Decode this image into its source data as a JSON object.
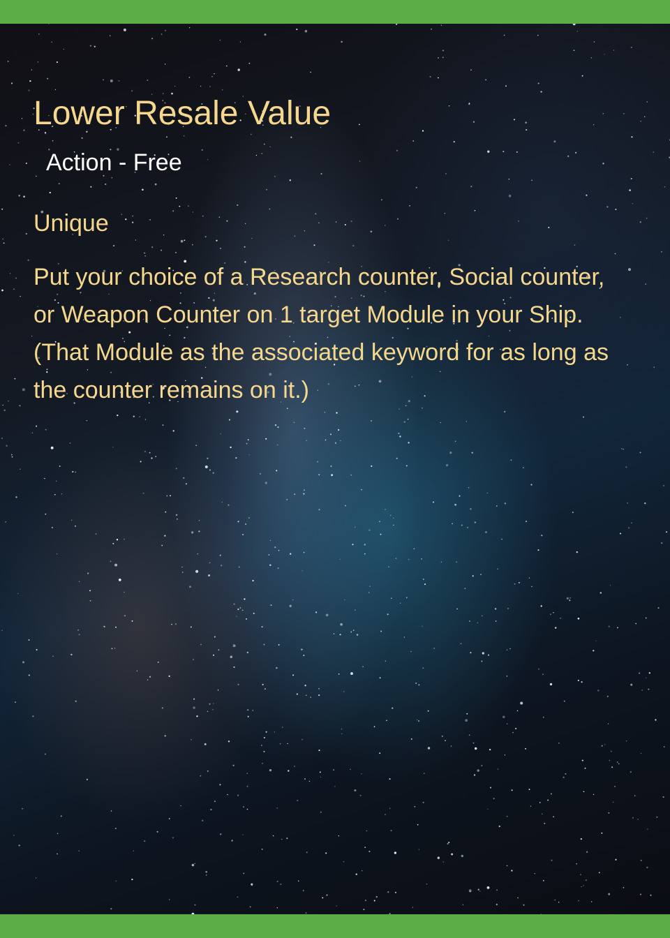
{
  "card": {
    "title": "Lower Resale Value",
    "type_line": "Action - Free",
    "keyword": "Unique",
    "rules_text": "Put your choice of a Research counter, Social counter, or Weapon Counter on 1 target Module in your Ship. (That Module as the associated keyword for as long as the counter remains on it.)"
  },
  "colors": {
    "border_bar": "#5aae45",
    "title_text": "#f5d78e",
    "type_text": "#ffffff"
  }
}
